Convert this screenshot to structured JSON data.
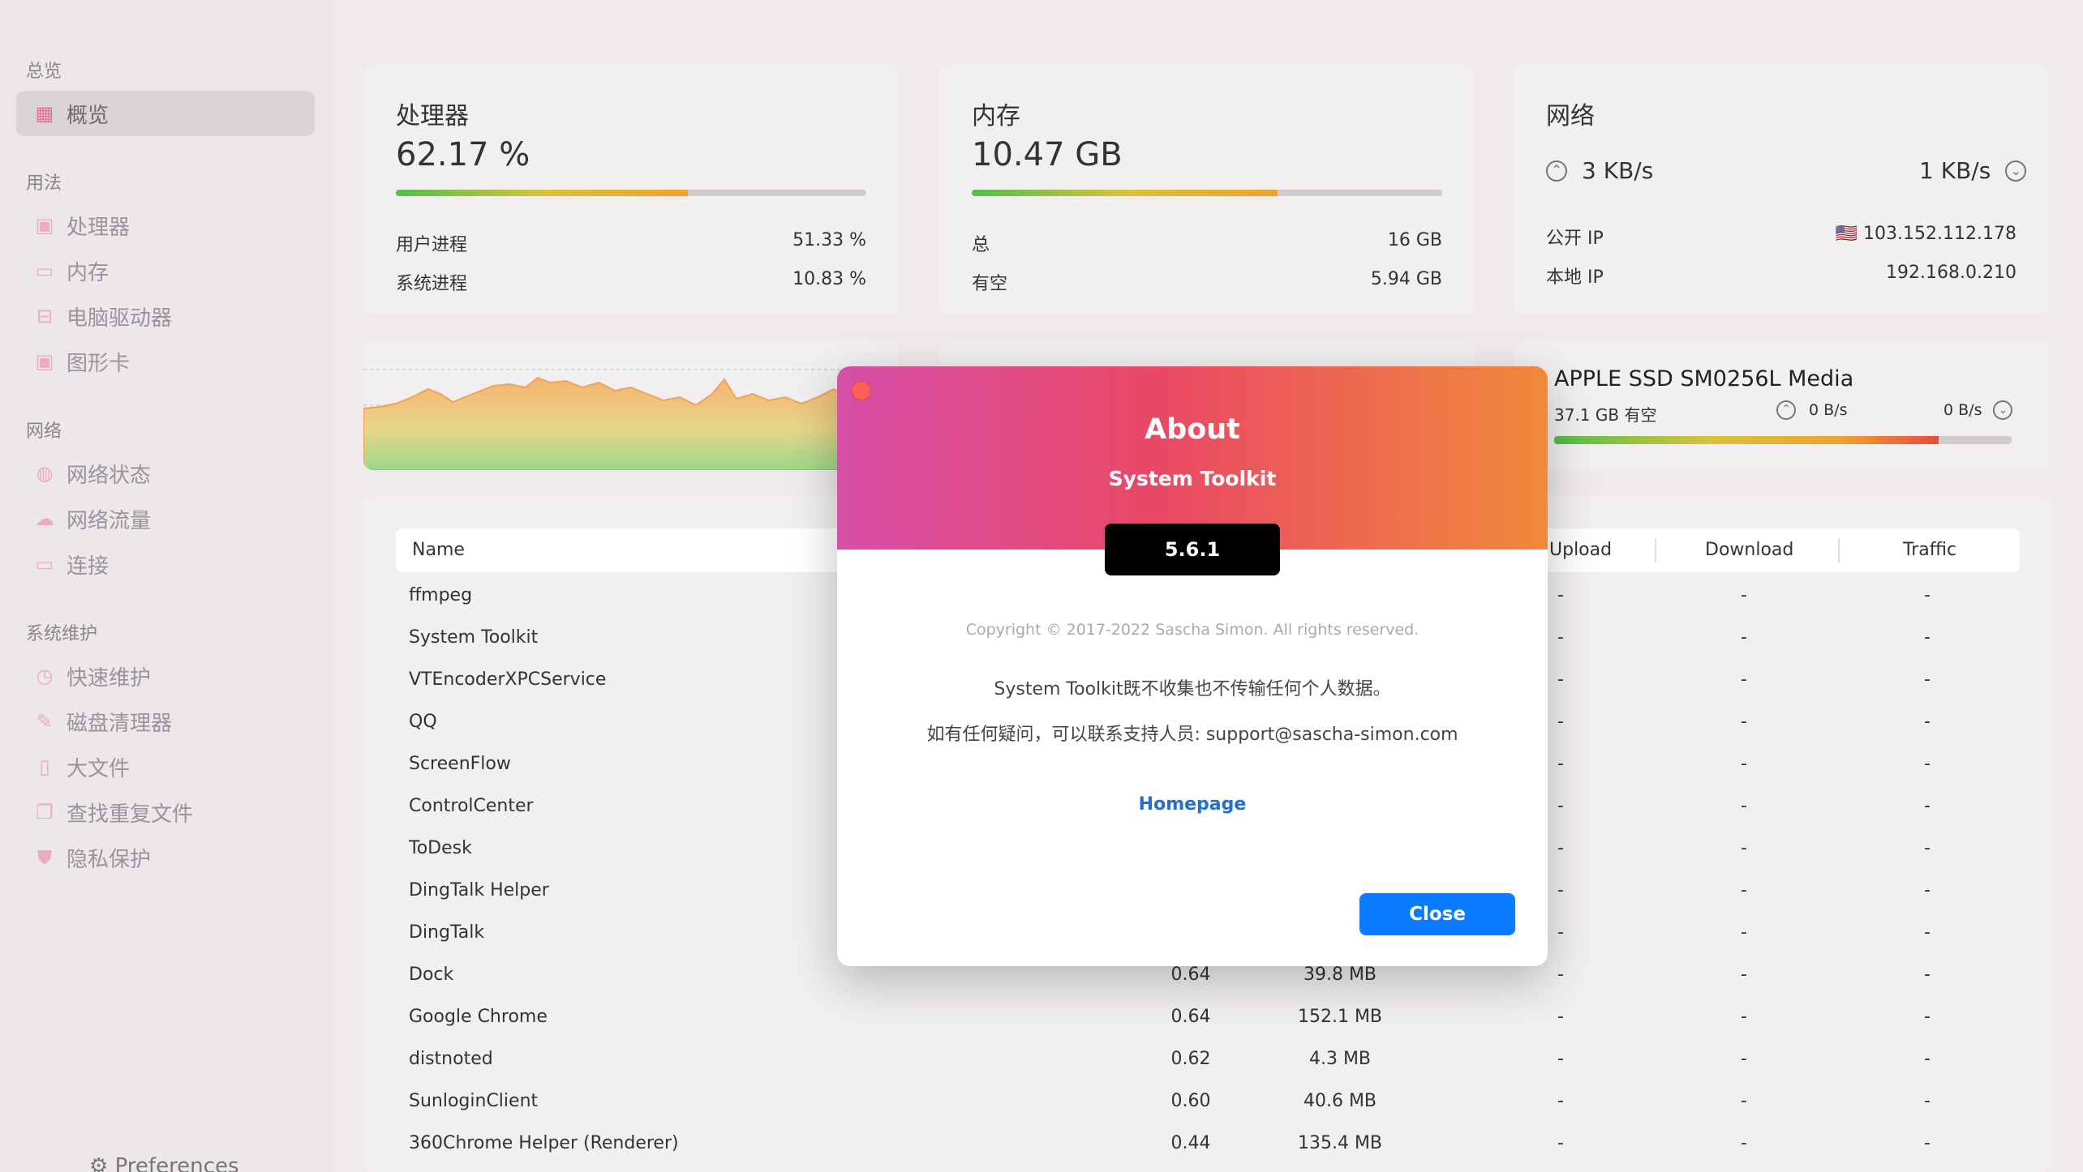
{
  "sidebar": {
    "sections": [
      {
        "title": "总览",
        "items": [
          {
            "label": "概览",
            "icon": "grid-icon",
            "active": true
          }
        ]
      },
      {
        "title": "用法",
        "items": [
          {
            "label": "处理器",
            "icon": "cpu-icon"
          },
          {
            "label": "内存",
            "icon": "memory-icon"
          },
          {
            "label": "电脑驱动器",
            "icon": "drive-icon"
          },
          {
            "label": "图形卡",
            "icon": "gpu-icon"
          }
        ]
      },
      {
        "title": "网络",
        "items": [
          {
            "label": "网络状态",
            "icon": "globe-icon"
          },
          {
            "label": "网络流量",
            "icon": "cloud-icon"
          },
          {
            "label": "连接",
            "icon": "monitor-icon"
          }
        ]
      },
      {
        "title": "系统维护",
        "items": [
          {
            "label": "快速维护",
            "icon": "stopwatch-icon"
          },
          {
            "label": "磁盘清理器",
            "icon": "broom-icon"
          },
          {
            "label": "大文件",
            "icon": "file-icon"
          },
          {
            "label": "查找重复文件",
            "icon": "duplicate-icon"
          },
          {
            "label": "隐私保护",
            "icon": "shield-icon"
          }
        ]
      }
    ],
    "preferences": "Preferences"
  },
  "cpu": {
    "title": "处理器",
    "value": "62.17 %",
    "usage_fraction": 0.62,
    "rows": [
      {
        "label": "用户进程",
        "value": "51.33 %"
      },
      {
        "label": "系统进程",
        "value": "10.83 %"
      }
    ]
  },
  "memory": {
    "title": "内存",
    "value": "10.47 GB",
    "usage_fraction": 0.65,
    "rows": [
      {
        "label": "总",
        "value": "16 GB"
      },
      {
        "label": "有空",
        "value": "5.94 GB"
      }
    ]
  },
  "network": {
    "title": "网络",
    "upload": "3 KB/s",
    "download": "1 KB/s",
    "public_ip_label": "公开 IP",
    "public_ip": "103.152.112.178",
    "flag": "🇺🇸",
    "local_ip_label": "本地 IP",
    "local_ip": "192.168.0.210"
  },
  "disk": {
    "name": "APPLE SSD SM0256L Media",
    "free": "37.1 GB 有空",
    "read": "0 B/s",
    "write": "0 B/s",
    "usage_fraction": 0.84
  },
  "table": {
    "headers": {
      "name": "Name",
      "upload": "Upload",
      "download": "Download",
      "traffic": "Traffic"
    },
    "rows": [
      {
        "name": "ffmpeg",
        "cpu": "",
        "mem": "",
        "up": "-",
        "down": "-",
        "traffic": "-"
      },
      {
        "name": "System Toolkit",
        "cpu": "",
        "mem": "",
        "up": "-",
        "down": "-",
        "traffic": "-"
      },
      {
        "name": "VTEncoderXPCService",
        "cpu": "",
        "mem": "",
        "up": "-",
        "down": "-",
        "traffic": "-"
      },
      {
        "name": "QQ",
        "cpu": "",
        "mem": "",
        "up": "-",
        "down": "-",
        "traffic": "-"
      },
      {
        "name": "ScreenFlow",
        "cpu": "",
        "mem": "",
        "up": "-",
        "down": "-",
        "traffic": "-"
      },
      {
        "name": "ControlCenter",
        "cpu": "",
        "mem": "",
        "up": "-",
        "down": "-",
        "traffic": "-"
      },
      {
        "name": "ToDesk",
        "cpu": "",
        "mem": "",
        "up": "-",
        "down": "-",
        "traffic": "-"
      },
      {
        "name": "DingTalk Helper",
        "cpu": "",
        "mem": "",
        "up": "-",
        "down": "-",
        "traffic": "-"
      },
      {
        "name": "DingTalk",
        "cpu": "",
        "mem": "",
        "up": "-",
        "down": "-",
        "traffic": "-"
      },
      {
        "name": "Dock",
        "cpu": "0.64",
        "mem": "39.8 MB",
        "up": "-",
        "down": "-",
        "traffic": "-"
      },
      {
        "name": "Google Chrome",
        "cpu": "0.64",
        "mem": "152.1 MB",
        "up": "-",
        "down": "-",
        "traffic": "-"
      },
      {
        "name": "distnoted",
        "cpu": "0.62",
        "mem": "4.3 MB",
        "up": "-",
        "down": "-",
        "traffic": "-"
      },
      {
        "name": "SunloginClient",
        "cpu": "0.60",
        "mem": "40.6 MB",
        "up": "-",
        "down": "-",
        "traffic": "-"
      },
      {
        "name": "360Chrome Helper (Renderer)",
        "cpu": "0.44",
        "mem": "135.4 MB",
        "up": "-",
        "down": "-",
        "traffic": "-"
      }
    ]
  },
  "about": {
    "title": "About",
    "app": "System Toolkit",
    "version": "5.6.1",
    "copyright": "Copyright © 2017-2022 Sascha Simon. All rights reserved.",
    "privacy": "System Toolkit既不收集也不传输任何个人数据。",
    "support": "如有任何疑问，可以联系支持人员: support@sascha-simon.com",
    "homepage": "Homepage",
    "close": "Close"
  },
  "colors": {
    "accent": "#0a7cff",
    "sidebar_icon": "#f0a9c3",
    "modal_gradient": [
      "#d64fa8",
      "#ea4865",
      "#f08a3b"
    ]
  }
}
